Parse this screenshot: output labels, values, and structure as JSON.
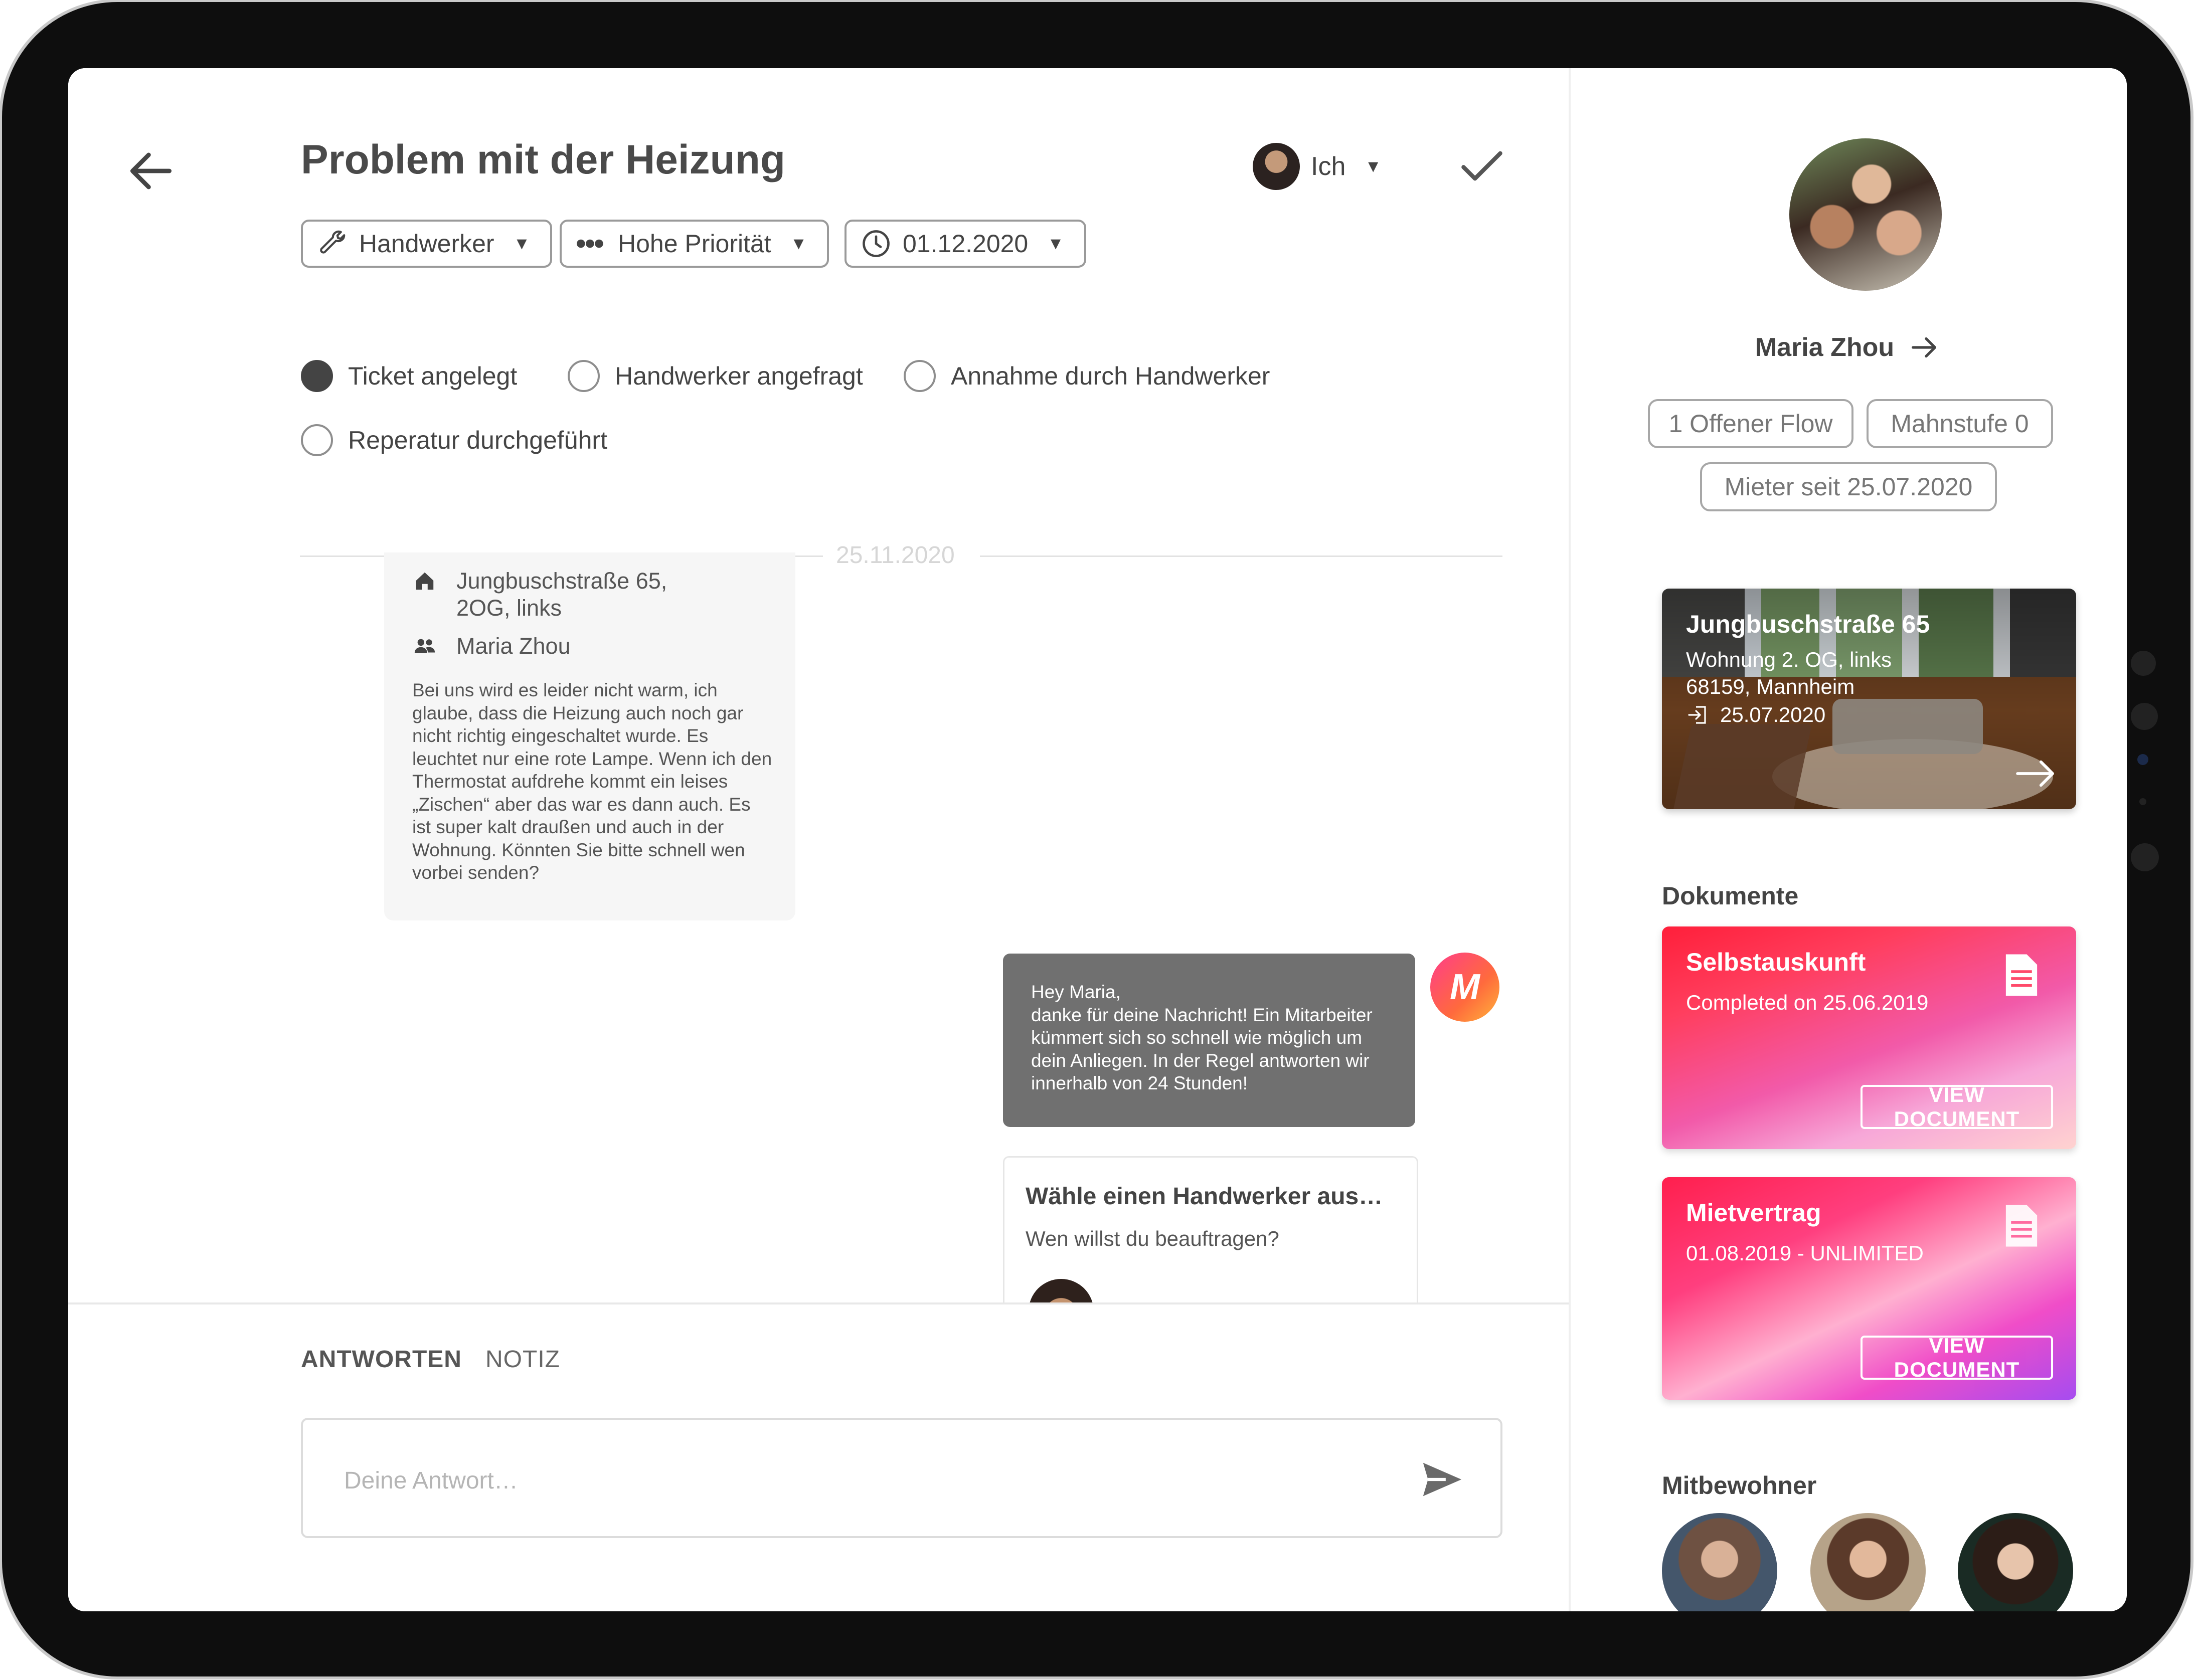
{
  "ticket": {
    "title": "Problem mit der Heizung",
    "assignee_label": "Ich",
    "filters": [
      {
        "label": "Handwerker",
        "icon": "wrench-icon"
      },
      {
        "label": "Hohe Priorität",
        "icon": "priority-dots-icon"
      },
      {
        "label": "01.12.2020",
        "icon": "clock-icon"
      }
    ],
    "statuses": [
      {
        "label": "Ticket angelegt",
        "done": true
      },
      {
        "label": "Handwerker angefragt",
        "done": false
      },
      {
        "label": "Annahme durch Handwerker",
        "done": false
      },
      {
        "label": "Reperatur durchgeführt",
        "done": false
      }
    ]
  },
  "conversation": {
    "date_separator": "25.11.2020",
    "tenant_message": {
      "address": "Jungbuschstraße 65,\n2OG, links",
      "author": "Maria Zhou",
      "text": "Bei uns wird es leider nicht warm, ich glaube, dass die Heizung auch noch gar nicht richtig eingeschaltet wurde. Es leuchtet nur eine rote Lampe. Wenn ich den Thermostat aufdrehe kommt ein leises „Zischen“ aber das war es dann auch. Es ist super kalt draußen und auch in der Wohnung. Könnten Sie bitte schnell wen vorbei senden?"
    },
    "reply_message": {
      "avatar_letter": "M",
      "text": "Hey Maria,\ndanke für deine Nachricht! Ein Mitarbeiter kümmert sich so schnell wie möglich um dein Anliegen. In der Regel antworten wir innerhalb von 24 Stunden!"
    },
    "craftsman_card": {
      "title": "Wähle einen Handwerker aus…",
      "subtitle": "Wen willst du beauftragen?"
    }
  },
  "composer": {
    "tab_reply": "ANTWORTEN",
    "tab_note": "NOTIZ",
    "placeholder": "Deine Antwort…"
  },
  "sidebar": {
    "name": "Maria Zhou",
    "tags": [
      "1 Offener Flow",
      "Mahnstufe 0",
      "Mieter seit 25.07.2020"
    ],
    "property": {
      "street": "Jungbuschstraße 65",
      "unit": "Wohnung 2. OG, links",
      "city": "68159, Mannheim",
      "move_in": "25.07.2020"
    },
    "documents_title": "Dokumente",
    "documents": [
      {
        "title": "Selbstauskunft",
        "subtitle": "Completed on 25.06.2019",
        "button": "VIEW DOCUMENT"
      },
      {
        "title": "Mietvertrag",
        "subtitle": "01.08.2019 - UNLIMITED",
        "button": "VIEW DOCUMENT"
      }
    ],
    "roommates_title": "Mitbewohner"
  },
  "colors": {
    "text_dark": "#444444",
    "bubble_gray": "#707070",
    "accent_pink": "#ff3d8b",
    "accent_red": "#ff1f3a"
  }
}
